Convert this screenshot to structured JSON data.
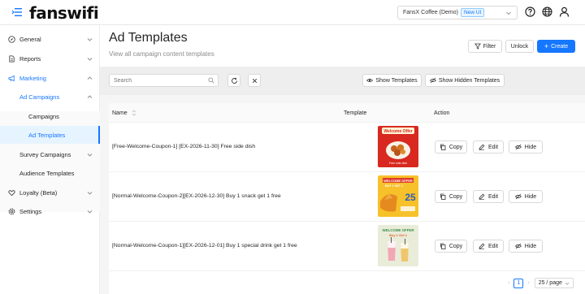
{
  "header": {
    "logo": "fanswifi",
    "store_name": "FansX Coffee (Demo)",
    "store_tag": "New UI"
  },
  "sidebar": {
    "items": [
      {
        "label": "General",
        "icon": "compass-icon"
      },
      {
        "label": "Reports",
        "icon": "file-icon"
      },
      {
        "label": "Marketing",
        "icon": "megaphone-icon"
      },
      {
        "label": "Ad Campaigns"
      },
      {
        "label": "Campaigns"
      },
      {
        "label": "Ad Templates"
      },
      {
        "label": "Survey Campaigns"
      },
      {
        "label": "Audience Templates"
      },
      {
        "label": "Loyalty (Beta)",
        "icon": "heart-icon"
      },
      {
        "label": "Settings",
        "icon": "gear-icon"
      }
    ]
  },
  "page": {
    "title": "Ad Templates",
    "subtitle": "View all campaign content templates",
    "filter_label": "Filter",
    "unlock_label": "Unlock",
    "create_label": "Create"
  },
  "toolbar": {
    "search_placeholder": "Search",
    "show_templates_label": "Show Templates",
    "show_hidden_label": "Show Hidden Templates"
  },
  "table": {
    "columns": {
      "name": "Name",
      "template": "Template",
      "action": "Action"
    },
    "rows": [
      {
        "name": "[Free-Welcome-Coupon-1] [EX-2026-11-30] Free side dish",
        "thumb_title": "Welcome Offer",
        "thumb_sub": "Free side dish"
      },
      {
        "name": "[Normal-Welcome-Coupon-2][EX-2026-12-30] Buy 1 snack get 1 free",
        "thumb_title": "WELCOME OFFER",
        "thumb_sub": "BUY 1 GET 1",
        "thumb_num": "25"
      },
      {
        "name": "[Normal-Welcome-Coupon-1][EX-2026-12-01] Buy 1 special drink get 1 free",
        "thumb_title": "WELCOME OFFER",
        "thumb_sub": "Buy 1 Get 1"
      }
    ],
    "actions": {
      "copy": "Copy",
      "edit": "Edit",
      "hide": "Hide"
    }
  },
  "pagination": {
    "current_page": "1",
    "page_size": "25 / page"
  },
  "colors": {
    "primary": "#1677ff",
    "selected_bg": "#e6f4ff",
    "toolbar_bg": "#eeeeee"
  }
}
